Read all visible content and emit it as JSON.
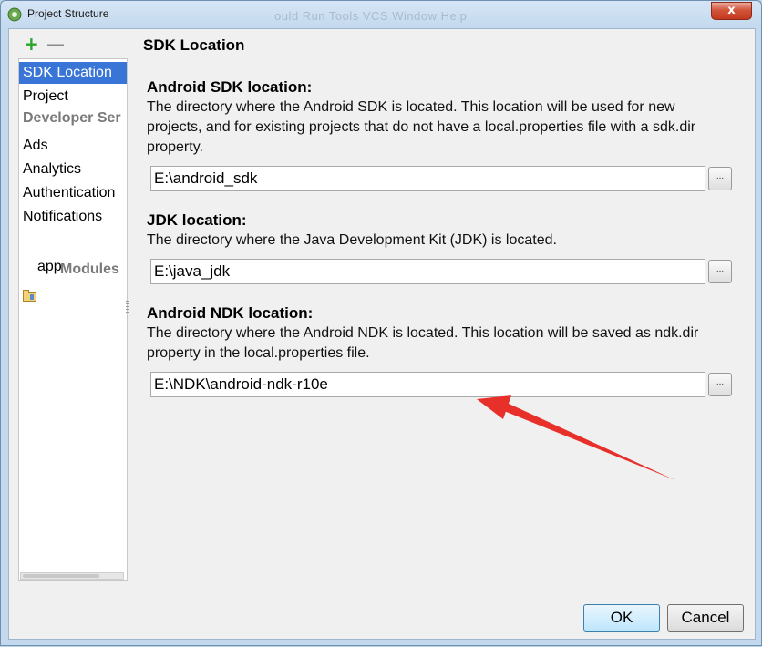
{
  "window": {
    "title": "Project Structure",
    "ghost_menu": "ould  Run  Tools  VCS  Window  Help",
    "close_label": "x"
  },
  "toolbar": {
    "add_label": "+",
    "remove_label": "—"
  },
  "sidebar": {
    "items": [
      {
        "label": "SDK Location",
        "selected": true
      },
      {
        "label": "Project"
      }
    ],
    "developer_header": "Developer Ser",
    "developer_items": [
      {
        "label": "Ads"
      },
      {
        "label": "Analytics"
      },
      {
        "label": "Authentication"
      },
      {
        "label": "Notifications"
      }
    ],
    "modules_header": "Modules",
    "modules": [
      {
        "label": "app",
        "icon": "module-folder-icon"
      }
    ]
  },
  "main": {
    "title": "SDK Location",
    "sections": [
      {
        "title": "Android SDK location:",
        "description": "The directory where the Android SDK is located. This location will be used for new projects, and for existing projects that do not have a local.properties file with a sdk.dir property.",
        "value": "E:\\android_sdk",
        "browse_label": "..."
      },
      {
        "title": "JDK location:",
        "description": "The directory where the Java Development Kit (JDK) is located.",
        "value": "E:\\java_jdk",
        "browse_label": "..."
      },
      {
        "title": "Android NDK location:",
        "description": "The directory where the Android NDK is located. This location will be saved as ndk.dir property in the local.properties file.",
        "value": "E:\\NDK\\android-ndk-r10e",
        "browse_label": "..."
      }
    ]
  },
  "buttons": {
    "ok": "OK",
    "cancel": "Cancel"
  },
  "colors": {
    "selection": "#3875d7",
    "annotation_arrow": "#e8302a",
    "add_icon": "#2aa52a"
  }
}
